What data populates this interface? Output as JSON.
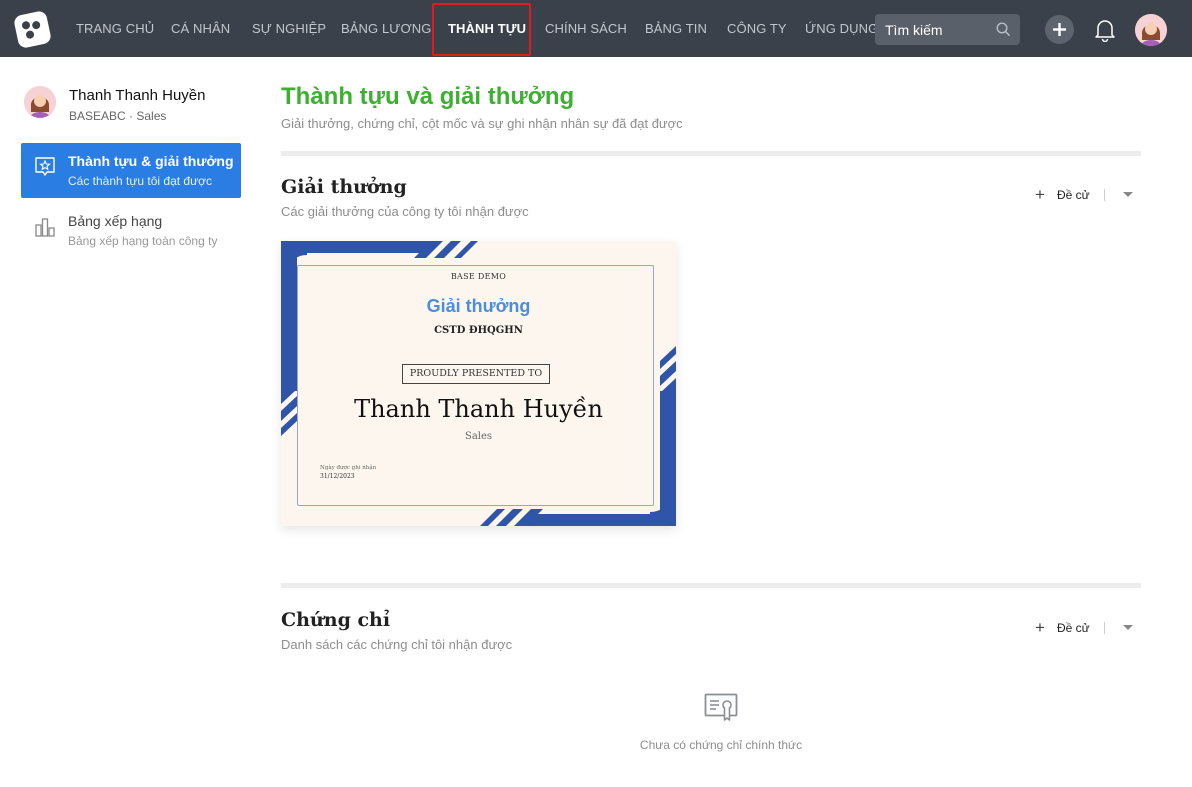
{
  "nav": {
    "items": [
      {
        "label": "TRANG CHỦ"
      },
      {
        "label": "CÁ NHÂN"
      },
      {
        "label": "SỰ NGHIỆP"
      },
      {
        "label": "BẢNG LƯƠNG"
      },
      {
        "label": "THÀNH TỰU"
      },
      {
        "label": "CHÍNH SÁCH"
      },
      {
        "label": "BẢNG TIN"
      },
      {
        "label": "CÔNG TY"
      },
      {
        "label": "ỨNG DỤNG"
      }
    ],
    "active_index": 4,
    "search_placeholder": "Tìm kiếm",
    "icons": [
      "logo-icon",
      "search-icon",
      "plus-icon",
      "bell-icon",
      "avatar"
    ],
    "active_highlight_color": "#e01c1c"
  },
  "sidebar": {
    "profile": {
      "name": "Thanh Thanh Huyền",
      "subtitle": "BASEABC · Sales"
    },
    "items": [
      {
        "title": "Thành tựu & giải thưởng",
        "subtitle": "Các thành tựu tôi đạt được",
        "icon": "award-star-icon",
        "active": true
      },
      {
        "title": "Bảng xếp hạng",
        "subtitle": "Bảng xếp hạng toàn công ty",
        "icon": "bar-chart-icon",
        "active": false
      }
    ],
    "active_color": "#2a7ee3"
  },
  "main": {
    "title": "Thành tựu và giải thưởng",
    "subtitle": "Giải thưởng, chứng chỉ, cột mốc và sự ghi nhận nhân sự đã đạt được",
    "title_color": "#3cb02f",
    "awards": {
      "title": "Giải thưởng",
      "subtitle": "Các giải thưởng của công ty tôi nhận được",
      "nominate_label": "Đề cử",
      "certificate": {
        "org": "BASE DEMO",
        "award": "Giải thưởng",
        "unit": "CSTD ĐHQGHN",
        "presented": "PROUDLY PRESENTED TO",
        "recipient": "Thanh Thanh Huyền",
        "role": "Sales",
        "date_label": "Ngày được ghi nhận",
        "date": "31/12/2023",
        "accent_color": "#2f54a8"
      }
    },
    "certs": {
      "title": "Chứng chỉ",
      "subtitle": "Danh sách các chứng chỉ tôi nhận được",
      "nominate_label": "Đề cử",
      "empty_text": "Chưa có chứng chỉ chính thức",
      "empty_icon": "certificate-icon"
    }
  }
}
